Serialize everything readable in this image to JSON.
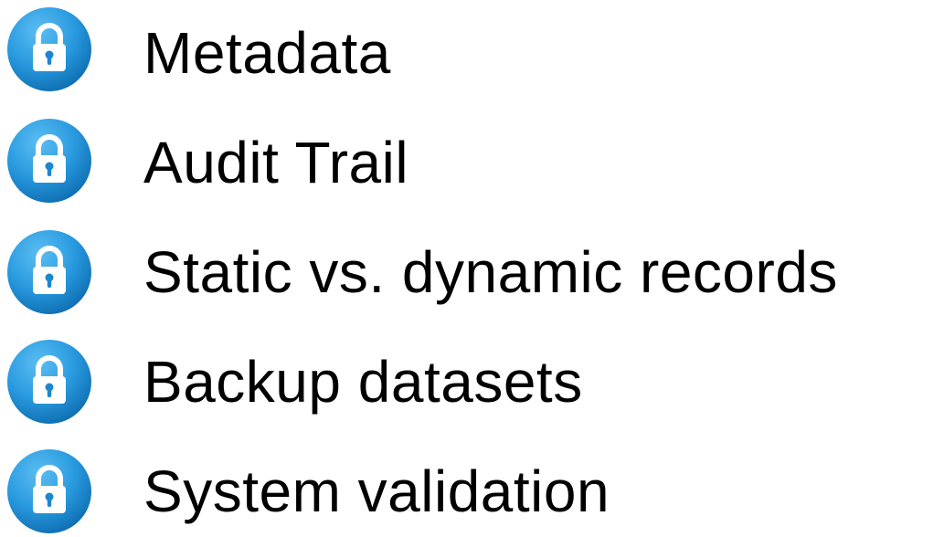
{
  "colors": {
    "icon_outer": "#0f6fb3",
    "icon_inner": "#2a9be0",
    "icon_highlight": "#5bbdf2",
    "lock": "#ffffff",
    "keyhole": "#1c86cf",
    "text": "#000000"
  },
  "icon": "padlock-circle-icon",
  "items": [
    {
      "label": "Metadata"
    },
    {
      "label": "Audit Trail"
    },
    {
      "label": "Static vs. dynamic records"
    },
    {
      "label": "Backup datasets"
    },
    {
      "label": "System validation"
    }
  ]
}
